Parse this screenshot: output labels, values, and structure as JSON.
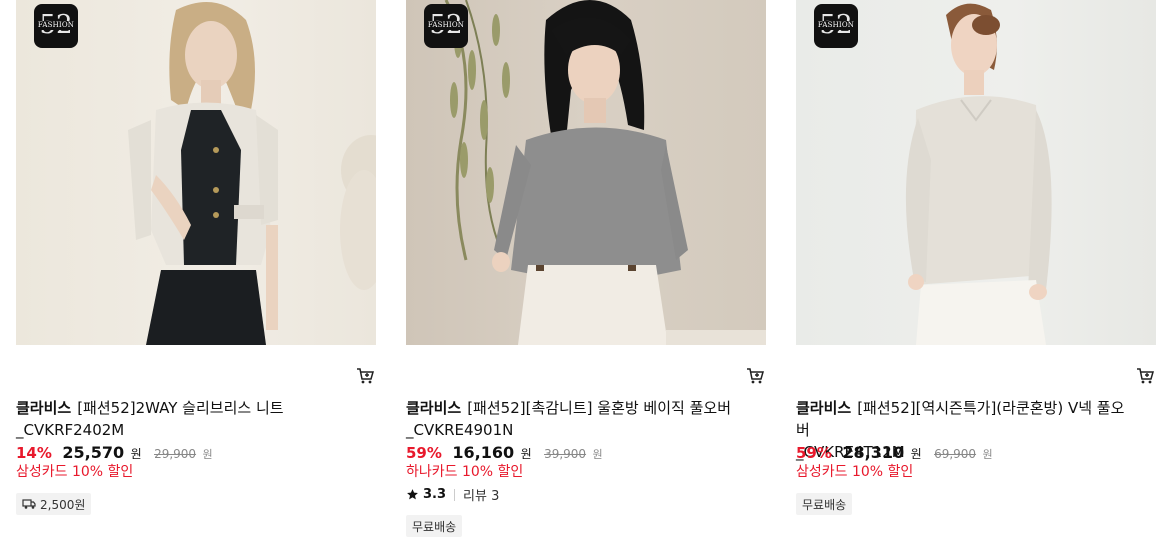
{
  "products": [
    {
      "badge": {
        "number": "52",
        "text": "FASHION"
      },
      "brand": "클라비스",
      "name_line1": "[패션52]2WAY 슬리브리스 니트",
      "name_line2": "_CVKRF2402M",
      "discount": "14%",
      "price": "25,570",
      "price_unit": "원",
      "original_price": "29,900",
      "original_unit": "원",
      "card_promo": "삼성카드 10% 할인",
      "shipping_chip": "2,500원",
      "shipping_icon": "truck-icon"
    },
    {
      "badge": {
        "number": "52",
        "text": "FASHION"
      },
      "brand": "클라비스",
      "name_line1": "[패션52][촉감니트] 울혼방 베이직 풀오버",
      "name_line2": "_CVKRE4901N",
      "discount": "59%",
      "price": "16,160",
      "price_unit": "원",
      "original_price": "39,900",
      "original_unit": "원",
      "card_promo": "하나카드 10% 할인",
      "rating": "3.3",
      "review_label": "리뷰 3",
      "shipping_chip": "무료배송"
    },
    {
      "badge": {
        "number": "52",
        "text": "FASHION"
      },
      "brand": "클라비스",
      "name_line1": "[패션52][역시즌특가](라쿤혼방) V넥 풀오버",
      "name_line2": "_CVKRE4T12M",
      "discount": "59%",
      "price": "28,310",
      "price_unit": "원",
      "original_price": "69,900",
      "original_unit": "원",
      "card_promo": "삼성카드 10% 할인",
      "shipping_chip": "무료배송"
    }
  ],
  "colors": {
    "discount": "#e8192c",
    "promo": "#e8192c",
    "chip_bg": "#f2f2f2"
  }
}
